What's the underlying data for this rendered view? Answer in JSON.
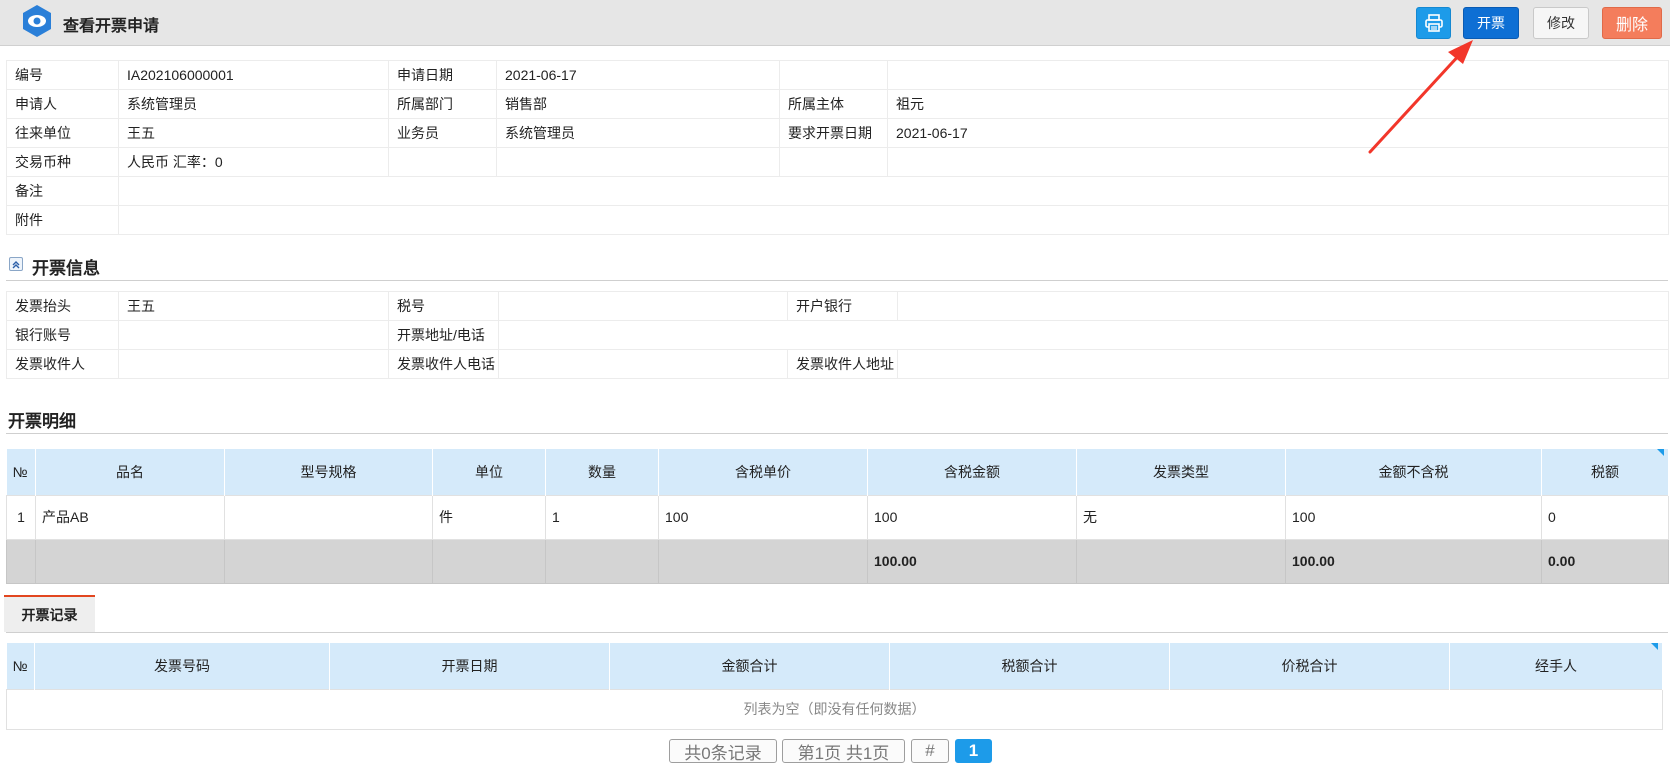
{
  "header": {
    "title": "查看开票申请",
    "buttons": {
      "issue": "开票",
      "edit": "修改",
      "delete": "删除"
    }
  },
  "basic_info": {
    "rows": [
      [
        {
          "label": "编号",
          "value": "IA202106000001"
        },
        {
          "label": "申请日期",
          "value": "2021-06-17"
        },
        {
          "label": "",
          "value": ""
        }
      ],
      [
        {
          "label": "申请人",
          "value": "系统管理员"
        },
        {
          "label": "所属部门",
          "value": "销售部"
        },
        {
          "label": "所属主体",
          "value": "祖元"
        }
      ],
      [
        {
          "label": "往来单位",
          "value": "王五"
        },
        {
          "label": "业务员",
          "value": "系统管理员"
        },
        {
          "label": "要求开票日期",
          "value": "2021-06-17"
        }
      ],
      [
        {
          "label": "交易币种",
          "value": "人民币 汇率：0"
        },
        {
          "label": "",
          "value": ""
        },
        {
          "label": "",
          "value": ""
        }
      ]
    ],
    "remarks_label": "备注",
    "remarks_value": "",
    "attachment_label": "附件",
    "attachment_value": ""
  },
  "invoice_info": {
    "title": "开票信息",
    "header_label": "发票抬头",
    "header_value": "王五",
    "tax_no_label": "税号",
    "tax_no_value": "",
    "bank_label": "开户银行",
    "bank_value": "",
    "account_label": "银行账号",
    "account_value": "",
    "address_label": "开票地址/电话",
    "address_value": "",
    "recipient_label": "发票收件人",
    "recipient_value": "",
    "recipient_phone_label": "发票收件人电话",
    "recipient_phone_value": "",
    "recipient_addr_label": "发票收件人地址",
    "recipient_addr_value": ""
  },
  "details": {
    "title": "开票明细",
    "columns": [
      "№",
      "品名",
      "型号规格",
      "单位",
      "数量",
      "含税单价",
      "含税金额",
      "发票类型",
      "金额不含税",
      "税额"
    ],
    "rows": [
      [
        "1",
        "产品AB",
        "",
        "件",
        "1",
        "100",
        "100",
        "无",
        "100",
        "0"
      ]
    ],
    "totals": {
      "tax_included_amount": "100.00",
      "amount_excl_tax": "100.00",
      "tax": "0.00"
    }
  },
  "records": {
    "tab_label": "开票记录",
    "columns": [
      "№",
      "发票号码",
      "开票日期",
      "金额合计",
      "税额合计",
      "价税合计",
      "经手人"
    ],
    "empty_text": "列表为空（即没有任何数据）"
  },
  "pagination": {
    "total_records": "共0条记录",
    "page_info": "第1页 共1页",
    "jump": "#",
    "current": "1"
  },
  "colors": {
    "primary": "#0e6fd4",
    "print": "#1d9be9",
    "delete": "#f47d5c",
    "grid_header": "#d5eafa",
    "arrow": "#f2362a"
  }
}
